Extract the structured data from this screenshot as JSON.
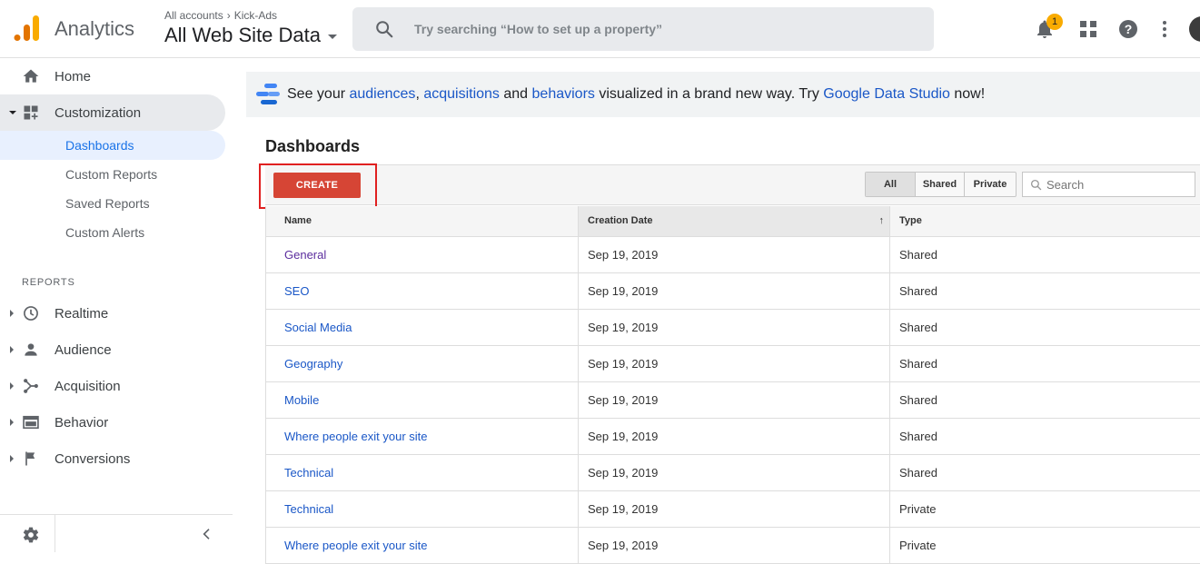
{
  "header": {
    "app_name": "Analytics",
    "breadcrumb": [
      "All accounts",
      "Kick-Ads"
    ],
    "breadcrumb_sep": "›",
    "view_name": "All Web Site Data",
    "search_placeholder": "Try searching “How to set up a property”",
    "notification_count": "1",
    "icons": [
      "search-icon",
      "bell-icon",
      "apps-grid-icon",
      "help-icon",
      "more-vert-icon"
    ]
  },
  "sidebar": {
    "home": "Home",
    "customization": "Customization",
    "sub_items": [
      {
        "label": "Dashboards",
        "active": true
      },
      {
        "label": "Custom Reports",
        "active": false
      },
      {
        "label": "Saved Reports",
        "active": false
      },
      {
        "label": "Custom Alerts",
        "active": false
      }
    ],
    "reports_header": "REPORTS",
    "reports": [
      {
        "label": "Realtime",
        "icon": "clock-icon"
      },
      {
        "label": "Audience",
        "icon": "person-icon"
      },
      {
        "label": "Acquisition",
        "icon": "acquisition-icon"
      },
      {
        "label": "Behavior",
        "icon": "behavior-icon"
      },
      {
        "label": "Conversions",
        "icon": "flag-icon"
      }
    ]
  },
  "banner": {
    "pre": "See your ",
    "link1": "audiences",
    "sep1": ", ",
    "link2": "acquisitions",
    "mid": " and ",
    "link3": "behaviors",
    "post": " visualized in a brand new way. Try ",
    "link4": "Google Data Studio",
    "end": " now!"
  },
  "main": {
    "title": "Dashboards",
    "create_label": "CREATE",
    "filters": [
      {
        "label": "All",
        "selected": true
      },
      {
        "label": "Shared",
        "selected": false
      },
      {
        "label": "Private",
        "selected": false
      }
    ],
    "search_placeholder": "Search",
    "columns": [
      "Name",
      "Creation Date",
      "Type"
    ],
    "sort_arrow": "↑",
    "rows": [
      {
        "name": "General",
        "date": "Sep 19, 2019",
        "type": "Shared",
        "visited": true
      },
      {
        "name": "SEO",
        "date": "Sep 19, 2019",
        "type": "Shared",
        "visited": false
      },
      {
        "name": "Social Media",
        "date": "Sep 19, 2019",
        "type": "Shared",
        "visited": false
      },
      {
        "name": "Geography",
        "date": "Sep 19, 2019",
        "type": "Shared",
        "visited": false
      },
      {
        "name": "Mobile",
        "date": "Sep 19, 2019",
        "type": "Shared",
        "visited": false
      },
      {
        "name": "Where people exit your site",
        "date": "Sep 19, 2019",
        "type": "Shared",
        "visited": false
      },
      {
        "name": "Technical",
        "date": "Sep 19, 2019",
        "type": "Shared",
        "visited": false
      },
      {
        "name": "Technical",
        "date": "Sep 19, 2019",
        "type": "Private",
        "visited": false
      },
      {
        "name": "Where people exit your site",
        "date": "Sep 19, 2019",
        "type": "Private",
        "visited": false
      }
    ]
  },
  "colors": {
    "accent": "#1a73e8",
    "create": "#d64535",
    "highlight": "#e02020",
    "link": "#1a57c7",
    "visited_link": "#5b2d9e"
  }
}
